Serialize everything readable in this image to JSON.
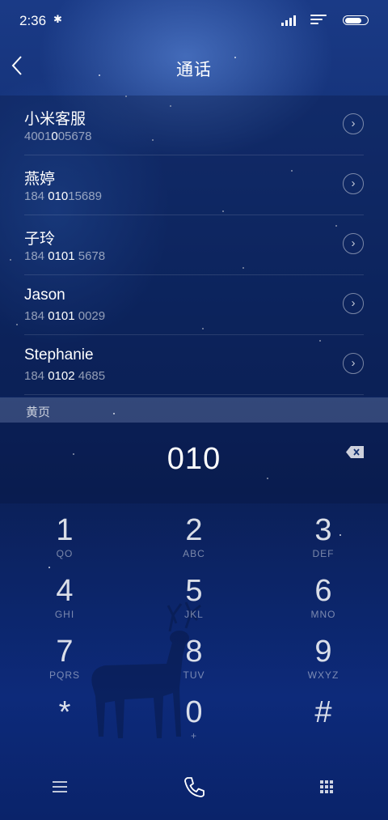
{
  "status_bar": {
    "time": "2:36",
    "bluetooth_icon": "bluetooth-icon",
    "signal_icon": "signal-icon",
    "wifi_icon": "wifi-icon",
    "battery_icon": "battery-icon"
  },
  "header": {
    "back_icon": "back-arrow-icon",
    "title": "通话"
  },
  "contacts": [
    {
      "name": "小米客服",
      "number_pre": "4001",
      "number_match": "0",
      "number_post": "05678"
    },
    {
      "name": "燕婷",
      "number_pre": "184 ",
      "number_match": "010",
      "number_post": "15689"
    },
    {
      "name": "子玲",
      "number_pre": "184 ",
      "number_match": "0101",
      "number_post": " 5678"
    },
    {
      "name": "Jason",
      "number_pre": "184 ",
      "number_match": "0101",
      "number_post": " 0029"
    },
    {
      "name": "Stephanie",
      "number_pre": "184 ",
      "number_match": "0102",
      "number_post": " 4685"
    }
  ],
  "section_label": "黄页",
  "dial_entry": {
    "digits": "010",
    "delete_icon": "backspace-icon"
  },
  "keypad": [
    {
      "digit": "1",
      "letters": "QO"
    },
    {
      "digit": "2",
      "letters": "ABC"
    },
    {
      "digit": "3",
      "letters": "DEF"
    },
    {
      "digit": "4",
      "letters": "GHI"
    },
    {
      "digit": "5",
      "letters": "JKL"
    },
    {
      "digit": "6",
      "letters": "MNO"
    },
    {
      "digit": "7",
      "letters": "PQRS"
    },
    {
      "digit": "8",
      "letters": "TUV"
    },
    {
      "digit": "9",
      "letters": "WXYZ"
    },
    {
      "digit": "*",
      "letters": ""
    },
    {
      "digit": "0",
      "letters": "+"
    },
    {
      "digit": "#",
      "letters": ""
    }
  ],
  "bottom_bar": {
    "menu_icon": "menu-icon",
    "call_icon": "phone-icon",
    "keypad_icon": "dialpad-icon"
  },
  "colors": {
    "accent": "#ffffff",
    "background_top": "#1a3a86",
    "background_bottom": "#0a236a"
  }
}
